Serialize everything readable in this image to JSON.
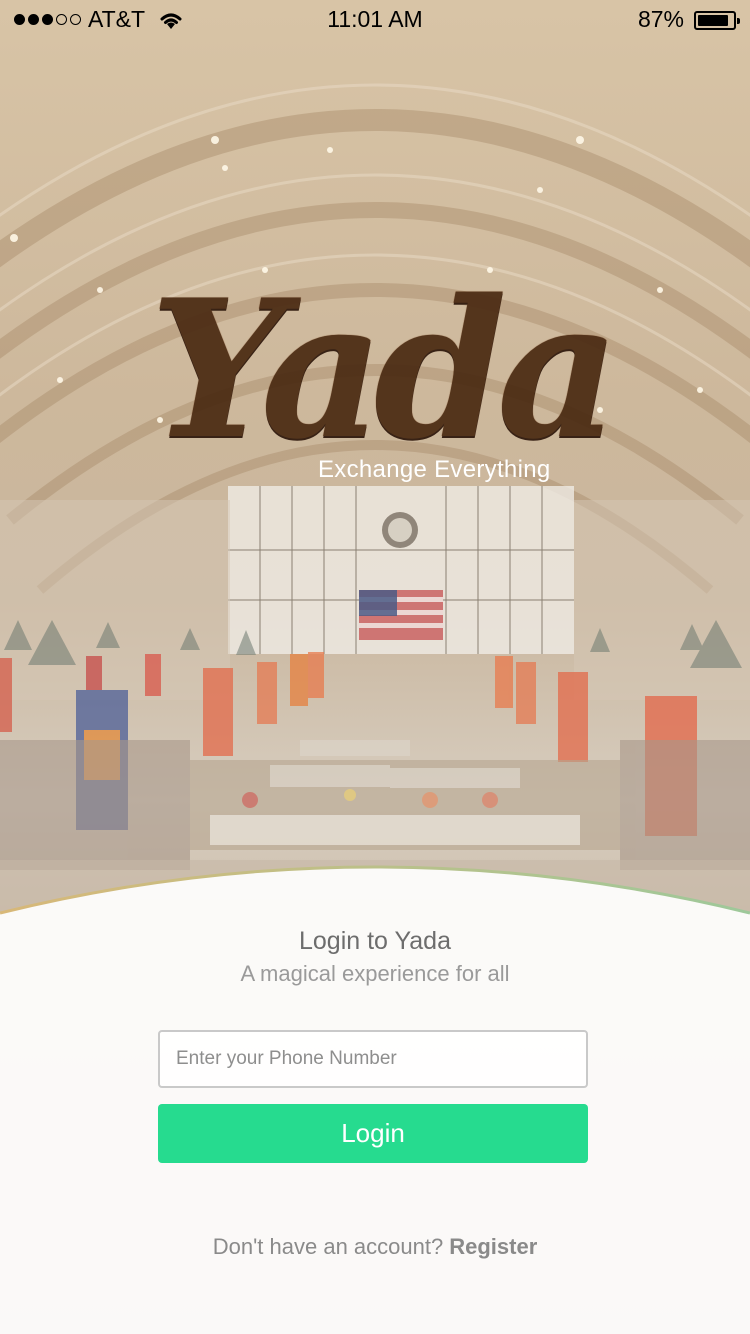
{
  "status_bar": {
    "signal": "●●●○○",
    "carrier": "AT&T",
    "time": "11:01 AM",
    "battery_percent": "87%",
    "battery_level": 0.87
  },
  "logo": {
    "app_name": "Yada",
    "tagline": "Exchange Everything"
  },
  "login": {
    "title": "Login to Yada",
    "subtitle": "A magical experience for all",
    "phone_placeholder": "Enter your Phone Number",
    "phone_value": "",
    "login_label": "Login",
    "register_prompt": "Don't have an account?",
    "register_label": "Register"
  },
  "colors": {
    "login_button": "#26db8f",
    "sheet_edge_left": "#d8b878",
    "sheet_edge_right": "#9ec89a",
    "logo_wood": "#4a2a12"
  },
  "icons": [
    "wifi-icon",
    "battery-icon",
    "signal-icon"
  ]
}
